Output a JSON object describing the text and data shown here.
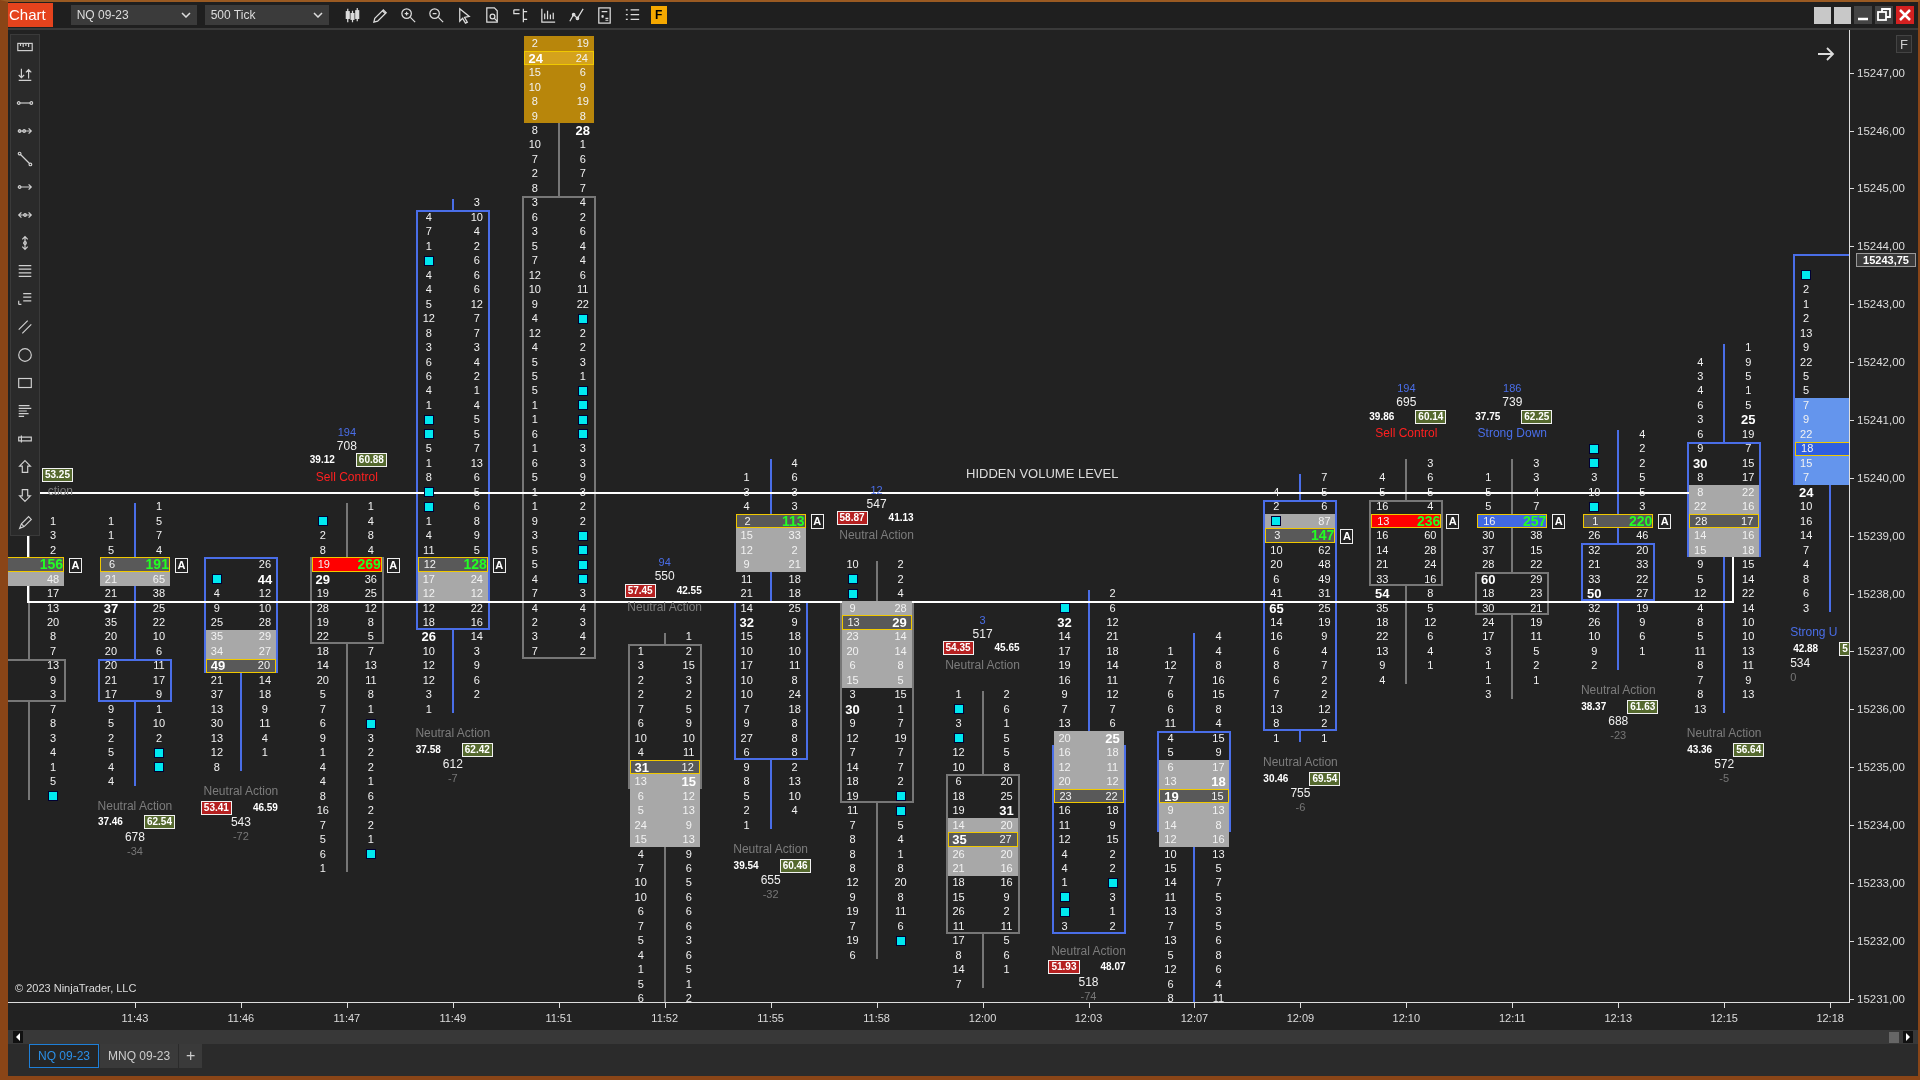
{
  "toolbar": {
    "app_label": "Chart",
    "instrument": "NQ 09-23",
    "interval": "500 Tick",
    "f_button": "F"
  },
  "chart": {
    "corner_button": "F",
    "hidden_volume_label": "HIDDEN VOLUME LEVEL",
    "copyright": "© 2023 NinjaTrader, LLC",
    "current_price": "15243,75",
    "price_labels": [
      "15247,00",
      "15246,00",
      "15245,00",
      "15244,00",
      "15243,00",
      "15242,00",
      "15241,00",
      "15240,00",
      "15239,00",
      "15238,00",
      "15237,00",
      "15236,00",
      "15235,00",
      "15234,00",
      "15233,00",
      "15232,00",
      "15231,00"
    ],
    "bars": [
      {
        "kind": "down",
        "poc": {
          "color": "#595959"
        },
        "value_area": {
          "color": "#a8a8a8"
        },
        "absorption": "A",
        "rows": [
          [
            "1"
          ],
          [
            "3"
          ],
          [
            "2"
          ],
          [
            "156"
          ],
          [
            "48"
          ],
          [
            "17"
          ],
          [
            "13"
          ],
          [
            "20"
          ],
          [
            "8"
          ],
          [
            "7"
          ],
          [
            "13"
          ],
          [
            "9"
          ],
          [
            "3"
          ],
          [
            "7"
          ],
          [
            "8"
          ],
          [
            "3"
          ],
          [
            "4"
          ],
          [
            "1"
          ],
          [
            "5"
          ],
          [
            {
              "marker": true
            }
          ]
        ],
        "summary": {
          "signal": {
            "text": "ction",
            "color": "#7c7c7c"
          },
          "ask_pct": {
            "text": "53.25",
            "boxed": true
          }
        }
      },
      {
        "time": "11:43",
        "kind": "up",
        "poc": {
          "color": "#595959"
        },
        "value_area": {
          "color": "#a8a8a8"
        },
        "absorption": "A",
        "rows": [
          [
            null,
            "1"
          ],
          [
            "1",
            "5"
          ],
          [
            "1",
            "7"
          ],
          [
            "5",
            "4"
          ],
          [
            "6",
            "191"
          ],
          [
            "21",
            "65"
          ],
          [
            "21",
            "38"
          ],
          [
            "37",
            "25"
          ],
          [
            "35",
            "22"
          ],
          [
            "20",
            "10"
          ],
          [
            "20",
            "6"
          ],
          [
            "20",
            "11"
          ],
          [
            "21",
            "17"
          ],
          [
            "17",
            "9"
          ],
          [
            "9",
            "1"
          ],
          [
            "5",
            "10"
          ],
          [
            "2",
            "2"
          ],
          [
            "5",
            {
              "marker": true
            }
          ],
          [
            "4",
            {
              "marker": true
            }
          ],
          [
            "4",
            null
          ]
        ],
        "summary": {
          "signal": {
            "text": "Neutral Action",
            "color": "#7c7c7c"
          },
          "bid_pct": {
            "text": "37.46",
            "boxed": false
          },
          "ask_pct": {
            "text": "62.54",
            "boxed": true
          },
          "volume": "678",
          "delta": "-34"
        }
      },
      {
        "time": "11:46",
        "kind": "up",
        "poc": {
          "color": "#595959"
        },
        "value_area": {
          "color": "#a8a8a8"
        },
        "rows": [
          [
            null,
            "26"
          ],
          [
            {
              "marker": true
            },
            "44"
          ],
          [
            "4",
            "12"
          ],
          [
            "9",
            "10"
          ],
          [
            "25",
            "28"
          ],
          [
            "35",
            "29"
          ],
          [
            "34",
            "27"
          ],
          [
            "49",
            "20"
          ],
          [
            "21",
            "14"
          ],
          [
            "37",
            "18"
          ],
          [
            "13",
            "9"
          ],
          [
            "30",
            "11"
          ],
          [
            "13",
            "4"
          ],
          [
            "12",
            "1"
          ],
          [
            "8",
            null
          ]
        ],
        "summary": {
          "signal": {
            "text": "Neutral Action",
            "color": "#7c7c7c"
          },
          "bid_pct": {
            "text": "53.41",
            "boxed": true
          },
          "ask_pct": {
            "text": "46.59",
            "boxed": false
          },
          "volume": "543",
          "delta": "-72"
        }
      },
      {
        "time": "11:47",
        "kind": "down",
        "poc": {
          "color": "#ff0000"
        },
        "absorption": "A",
        "rows": [
          [
            null,
            "1"
          ],
          [
            {
              "marker": true
            },
            "4"
          ],
          [
            "2",
            "8"
          ],
          [
            "8",
            "4"
          ],
          [
            "19",
            "269"
          ],
          [
            "29",
            "36"
          ],
          [
            "19",
            "25"
          ],
          [
            "28",
            "12"
          ],
          [
            "19",
            "8"
          ],
          [
            "22",
            "5"
          ],
          [
            "18",
            "7"
          ],
          [
            "14",
            "13"
          ],
          [
            "20",
            "11"
          ],
          [
            "5",
            "8"
          ],
          [
            "7",
            "1"
          ],
          [
            "6",
            {
              "marker": true
            }
          ],
          [
            "9",
            "3"
          ],
          [
            "1",
            "2"
          ],
          [
            "4",
            "2"
          ],
          [
            "4",
            "1"
          ],
          [
            "8",
            "6"
          ],
          [
            "16",
            "2"
          ],
          [
            "7",
            "2"
          ],
          [
            "5",
            "1"
          ],
          [
            "6",
            {
              "marker": true
            }
          ],
          [
            "1",
            null
          ]
        ],
        "summary": {
          "signal": {
            "text": "Sell Control",
            "color": "#ff2020"
          },
          "bid_pct": {
            "text": "39.12",
            "boxed": false
          },
          "ask_pct": {
            "text": "60.88",
            "boxed": true
          },
          "volume": "708",
          "delta": "194"
        }
      },
      {
        "time": "11:49",
        "kind": "up",
        "poc": {
          "color": "#595959"
        },
        "value_area": {
          "color": "#a8a8a8"
        },
        "absorption": "A",
        "rows": [
          [
            null,
            "3"
          ],
          [
            "4",
            "10"
          ],
          [
            "7",
            "4"
          ],
          [
            "1",
            "2"
          ],
          [
            {
              "marker": true
            },
            "6"
          ],
          [
            "4",
            "6"
          ],
          [
            "4",
            "6"
          ],
          [
            "5",
            "12"
          ],
          [
            "12",
            "7"
          ],
          [
            "8",
            "7"
          ],
          [
            "3",
            "3"
          ],
          [
            "6",
            "4"
          ],
          [
            "6",
            "2"
          ],
          [
            "4",
            "1"
          ],
          [
            "1",
            "4"
          ],
          [
            {
              "marker": true
            },
            "5"
          ],
          [
            {
              "marker": true
            },
            "5"
          ],
          [
            "5",
            "7"
          ],
          [
            "1",
            "13"
          ],
          [
            "8",
            "6"
          ],
          [
            {
              "marker": true
            },
            "5"
          ],
          [
            {
              "marker": true
            },
            "6"
          ],
          [
            "1",
            "8"
          ],
          [
            "4",
            "9"
          ],
          [
            "11",
            "5"
          ],
          [
            "12",
            "128"
          ],
          [
            "17",
            "24"
          ],
          [
            "12",
            "12"
          ],
          [
            "12",
            "22"
          ],
          [
            "18",
            "16"
          ],
          [
            "26",
            "14"
          ],
          [
            "10",
            "3"
          ],
          [
            "12",
            "9"
          ],
          [
            "12",
            "6"
          ],
          [
            "3",
            "2"
          ],
          [
            "1",
            null
          ]
        ],
        "summary": {
          "signal": {
            "text": "Neutral Action",
            "color": "#7c7c7c"
          },
          "bid_pct": {
            "text": "37.58",
            "boxed": false
          },
          "ask_pct": {
            "text": "62.42",
            "boxed": true
          },
          "volume": "612",
          "delta": "-7"
        }
      },
      {
        "time": "11:51",
        "kind": "down",
        "poc": {
          "color": "#d4a21c"
        },
        "value_area": {
          "color": "#b8860b"
        },
        "rows": [
          [
            "2",
            "19"
          ],
          [
            "24",
            "24"
          ],
          [
            "15",
            "6"
          ],
          [
            "10",
            "9"
          ],
          [
            "8",
            "19"
          ],
          [
            "9",
            "8"
          ],
          [
            "8",
            "28"
          ],
          [
            "10",
            "1"
          ],
          [
            "7",
            "6"
          ],
          [
            "2",
            "7"
          ],
          [
            "8",
            "7"
          ],
          [
            "3",
            "4"
          ],
          [
            "6",
            "2"
          ],
          [
            "3",
            "6"
          ],
          [
            "5",
            "4"
          ],
          [
            "7",
            "4"
          ],
          [
            "12",
            "6"
          ],
          [
            "10",
            "11"
          ],
          [
            "9",
            "22"
          ],
          [
            "4",
            {
              "marker": true
            }
          ],
          [
            "12",
            "2"
          ],
          [
            "4",
            "2"
          ],
          [
            "5",
            "3"
          ],
          [
            "5",
            "1"
          ],
          [
            "5",
            {
              "marker": true
            }
          ],
          [
            "1",
            {
              "marker": true
            }
          ],
          [
            "1",
            {
              "marker": true
            }
          ],
          [
            "6",
            {
              "marker": true
            }
          ],
          [
            "1",
            "3"
          ],
          [
            "6",
            "3"
          ],
          [
            "5",
            "9"
          ],
          [
            "1",
            "3"
          ],
          [
            "1",
            "2"
          ],
          [
            "9",
            "2"
          ],
          [
            "3",
            {
              "marker": true
            }
          ],
          [
            "5",
            {
              "marker": true
            }
          ],
          [
            "5",
            {
              "marker": true
            }
          ],
          [
            "4",
            {
              "marker": true
            }
          ],
          [
            "7",
            "3"
          ],
          [
            "4",
            "4"
          ],
          [
            "2",
            "3"
          ],
          [
            "3",
            "4"
          ],
          [
            "7",
            "2"
          ]
        ]
      },
      {
        "time": "11:52",
        "kind": "down",
        "poc": {
          "color": "#595959"
        },
        "value_area": {
          "color": "#a8a8a8"
        },
        "rows": [
          [
            null,
            "1"
          ],
          [
            "1",
            "2"
          ],
          [
            "3",
            "15"
          ],
          [
            "2",
            "3"
          ],
          [
            "2",
            "2"
          ],
          [
            "7",
            "5"
          ],
          [
            "6",
            "9"
          ],
          [
            "10",
            "10"
          ],
          [
            "4",
            "11"
          ],
          [
            "31",
            "12"
          ],
          [
            "13",
            "15"
          ],
          [
            "6",
            "12"
          ],
          [
            "5",
            "13"
          ],
          [
            "24",
            "9"
          ],
          [
            "15",
            "13"
          ],
          [
            "4",
            "9"
          ],
          [
            "7",
            "6"
          ],
          [
            "10",
            "5"
          ],
          [
            "10",
            "6"
          ],
          [
            "6",
            "6"
          ],
          [
            "7",
            "6"
          ],
          [
            "5",
            "3"
          ],
          [
            "4",
            "6"
          ],
          [
            "1",
            "5"
          ],
          [
            "5",
            "1"
          ],
          [
            "6",
            "2"
          ]
        ],
        "summary": {
          "signal": {
            "text": "Neutral Action",
            "color": "#7c7c7c"
          },
          "bid_pct": {
            "text": "57.45",
            "boxed": true
          },
          "ask_pct": {
            "text": "42.55",
            "boxed": false
          },
          "volume": "550",
          "delta": "94"
        }
      },
      {
        "time": "11:55",
        "kind": "up",
        "poc": {
          "color": "#595959"
        },
        "value_area": {
          "color": "#a8a8a8"
        },
        "absorption": "A",
        "rows": [
          [
            null,
            "4"
          ],
          [
            "1",
            "6"
          ],
          [
            "3",
            "3"
          ],
          [
            "4",
            "3"
          ],
          [
            "2",
            "113"
          ],
          [
            "15",
            "33"
          ],
          [
            "12",
            "2"
          ],
          [
            "9",
            "21"
          ],
          [
            "11",
            "18"
          ],
          [
            "21",
            "18"
          ],
          [
            "14",
            "25"
          ],
          [
            "32",
            "9"
          ],
          [
            "15",
            "18"
          ],
          [
            "10",
            "10"
          ],
          [
            "17",
            "11"
          ],
          [
            "10",
            "8"
          ],
          [
            "10",
            "24"
          ],
          [
            "7",
            "18"
          ],
          [
            "9",
            "8"
          ],
          [
            "27",
            "8"
          ],
          [
            "6",
            "8"
          ],
          [
            "9",
            "2"
          ],
          [
            "8",
            "13"
          ],
          [
            "5",
            "10"
          ],
          [
            "2",
            "4"
          ],
          [
            "1",
            null
          ]
        ],
        "summary": {
          "signal": {
            "text": "Neutral Action",
            "color": "#7c7c7c"
          },
          "bid_pct": {
            "text": "39.54",
            "boxed": false
          },
          "ask_pct": {
            "text": "60.46",
            "boxed": true
          },
          "volume": "655",
          "delta": "-32"
        }
      },
      {
        "time": "11:58",
        "kind": "down",
        "poc": {
          "color": "#595959"
        },
        "value_area": {
          "color": "#a8a8a8"
        },
        "rows": [
          [
            "10",
            "2"
          ],
          [
            {
              "marker": true
            },
            "2"
          ],
          [
            {
              "marker": true
            },
            "4"
          ],
          [
            "9",
            "28"
          ],
          [
            "13",
            "29"
          ],
          [
            "23",
            "14"
          ],
          [
            "20",
            "14"
          ],
          [
            "6",
            "8"
          ],
          [
            "15",
            "5"
          ],
          [
            "3",
            "15"
          ],
          [
            "30",
            "1"
          ],
          [
            "9",
            "7"
          ],
          [
            "12",
            "19"
          ],
          [
            "7",
            "7"
          ],
          [
            "14",
            "7"
          ],
          [
            "18",
            "2"
          ],
          [
            "19",
            {
              "marker": true
            }
          ],
          [
            "11",
            {
              "marker": true
            }
          ],
          [
            "7",
            "5"
          ],
          [
            "8",
            "4"
          ],
          [
            "8",
            "1"
          ],
          [
            "8",
            "8"
          ],
          [
            "12",
            "20"
          ],
          [
            "9",
            "8"
          ],
          [
            "19",
            "11"
          ],
          [
            "7",
            "6"
          ],
          [
            "19",
            {
              "marker": true
            }
          ],
          [
            "6",
            null
          ]
        ],
        "summary": {
          "signal": {
            "text": "Neutral Action",
            "color": "#7c7c7c"
          },
          "bid_pct": {
            "text": "58.87",
            "boxed": true
          },
          "ask_pct": {
            "text": "41.13",
            "boxed": false
          },
          "volume": "547",
          "delta": "12"
        }
      },
      {
        "time": "12:00",
        "kind": "down",
        "poc": {
          "color": "#595959"
        },
        "value_area": {
          "color": "#a8a8a8"
        },
        "rows": [
          [
            "1",
            "2"
          ],
          [
            {
              "marker": true
            },
            "6"
          ],
          [
            "3",
            "1"
          ],
          [
            {
              "marker": true
            },
            "5"
          ],
          [
            "12",
            "5"
          ],
          [
            "10",
            "8"
          ],
          [
            "6",
            "20"
          ],
          [
            "18",
            "25"
          ],
          [
            "19",
            "31"
          ],
          [
            "14",
            "20"
          ],
          [
            "35",
            "27"
          ],
          [
            "26",
            "20"
          ],
          [
            "21",
            "16"
          ],
          [
            "18",
            "16"
          ],
          [
            "15",
            "9"
          ],
          [
            "26",
            "2"
          ],
          [
            "11",
            "11"
          ],
          [
            "17",
            "5"
          ],
          [
            "8",
            "6"
          ],
          [
            "14",
            "1"
          ],
          [
            "7",
            null
          ]
        ],
        "summary": {
          "signal": {
            "text": "Neutral Action",
            "color": "#7c7c7c"
          },
          "bid_pct": {
            "text": "54.35",
            "boxed": true
          },
          "ask_pct": {
            "text": "45.65",
            "boxed": false
          },
          "volume": "517",
          "delta": "3"
        }
      },
      {
        "time": "12:03",
        "kind": "up",
        "poc": {
          "color": "#595959"
        },
        "value_area": {
          "color": "#a8a8a8"
        },
        "rows": [
          [
            null,
            "2"
          ],
          [
            {
              "marker": true
            },
            "6"
          ],
          [
            "32",
            "12"
          ],
          [
            "14",
            "21"
          ],
          [
            "17",
            "18"
          ],
          [
            "19",
            "14"
          ],
          [
            "16",
            "11"
          ],
          [
            "9",
            "12"
          ],
          [
            "7",
            "7"
          ],
          [
            "13",
            "6"
          ],
          [
            "20",
            "25"
          ],
          [
            "16",
            "18"
          ],
          [
            "12",
            "11"
          ],
          [
            "20",
            "12"
          ],
          [
            "23",
            "22"
          ],
          [
            "16",
            "18"
          ],
          [
            "11",
            "9"
          ],
          [
            "12",
            "15"
          ],
          [
            "4",
            "2"
          ],
          [
            "4",
            "2"
          ],
          [
            "1",
            {
              "marker": true
            }
          ],
          [
            {
              "marker": true
            },
            "3"
          ],
          [
            {
              "marker": true
            },
            "1"
          ],
          [
            "3",
            "2"
          ]
        ],
        "summary": {
          "signal": {
            "text": "Neutral Action",
            "color": "#7c7c7c"
          },
          "bid_pct": {
            "text": "51.93",
            "boxed": true
          },
          "ask_pct": {
            "text": "48.07",
            "boxed": false
          },
          "volume": "518",
          "delta": "-74"
        }
      },
      {
        "time": "12:07",
        "kind": "up",
        "poc": {
          "color": "#595959"
        },
        "value_area": {
          "color": "#a8a8a8"
        },
        "rows": [
          [
            null,
            "4"
          ],
          [
            "1",
            "4"
          ],
          [
            "12",
            "8"
          ],
          [
            "7",
            "16"
          ],
          [
            "6",
            "15"
          ],
          [
            "6",
            "8"
          ],
          [
            "11",
            "4"
          ],
          [
            "4",
            "15"
          ],
          [
            "5",
            "9"
          ],
          [
            "6",
            "17"
          ],
          [
            "13",
            "18"
          ],
          [
            "19",
            "15"
          ],
          [
            "9",
            "13"
          ],
          [
            "14",
            "8"
          ],
          [
            "12",
            "16"
          ],
          [
            "10",
            "13"
          ],
          [
            "15",
            "5"
          ],
          [
            "14",
            "7"
          ],
          [
            "11",
            "5"
          ],
          [
            "13",
            "3"
          ],
          [
            "7",
            "5"
          ],
          [
            "13",
            "6"
          ],
          [
            "5",
            "8"
          ],
          [
            "12",
            "6"
          ],
          [
            "6",
            "4"
          ],
          [
            "8",
            "11"
          ]
        ]
      },
      {
        "time": "12:09",
        "kind": "up",
        "poc": {
          "color": "#595959"
        },
        "value_area": {
          "color": "#a8a8a8"
        },
        "absorption": "A",
        "rows": [
          [
            null,
            "7"
          ],
          [
            "4",
            "5"
          ],
          [
            "2",
            "6"
          ],
          [
            {
              "marker": true
            },
            "87"
          ],
          [
            "3",
            "147"
          ],
          [
            "10",
            "62"
          ],
          [
            "20",
            "48"
          ],
          [
            "6",
            "49"
          ],
          [
            "41",
            "31"
          ],
          [
            "65",
            "25"
          ],
          [
            "14",
            "19"
          ],
          [
            "16",
            "9"
          ],
          [
            "6",
            "4"
          ],
          [
            "8",
            "7"
          ],
          [
            "6",
            "2"
          ],
          [
            "7",
            "2"
          ],
          [
            "13",
            "12"
          ],
          [
            "8",
            "2"
          ],
          [
            "1",
            "1"
          ]
        ],
        "summary": {
          "signal": {
            "text": "Neutral Action",
            "color": "#7c7c7c"
          },
          "bid_pct": {
            "text": "30.46",
            "boxed": false
          },
          "ask_pct": {
            "text": "69.54",
            "boxed": true
          },
          "volume": "755",
          "delta": "-6"
        }
      },
      {
        "time": "12:10",
        "kind": "down",
        "poc": {
          "color": "#ff0000"
        },
        "absorption": "A",
        "rows": [
          [
            null,
            "3"
          ],
          [
            "4",
            "6"
          ],
          [
            "5",
            "5"
          ],
          [
            "16",
            "4"
          ],
          [
            "13",
            "236"
          ],
          [
            "16",
            "60"
          ],
          [
            "14",
            "28"
          ],
          [
            "21",
            "24"
          ],
          [
            "33",
            "16"
          ],
          [
            "54",
            "8"
          ],
          [
            "35",
            "5"
          ],
          [
            "18",
            "12"
          ],
          [
            "22",
            "6"
          ],
          [
            "13",
            "4"
          ],
          [
            "9",
            "1"
          ],
          [
            "4",
            null
          ]
        ],
        "summary": {
          "signal": {
            "text": "Sell Control",
            "color": "#ff2020"
          },
          "bid_pct": {
            "text": "39.86",
            "boxed": false
          },
          "ask_pct": {
            "text": "60.14",
            "boxed": true
          },
          "volume": "695",
          "delta": "194"
        }
      },
      {
        "time": "12:11",
        "kind": "down",
        "poc": {
          "color": "#4169e1"
        },
        "absorption": "A",
        "rows": [
          [
            null,
            "3"
          ],
          [
            "1",
            "3"
          ],
          [
            "5",
            "4"
          ],
          [
            "5",
            "7"
          ],
          [
            "16",
            "257"
          ],
          [
            "30",
            "38"
          ],
          [
            "37",
            "15"
          ],
          [
            "28",
            "22"
          ],
          [
            "60",
            "29"
          ],
          [
            "18",
            "23"
          ],
          [
            "30",
            "21"
          ],
          [
            "24",
            "19"
          ],
          [
            "17",
            "11"
          ],
          [
            "3",
            "5"
          ],
          [
            "1",
            "2"
          ],
          [
            "1",
            "1"
          ],
          [
            "3",
            null
          ]
        ],
        "summary": {
          "signal": {
            "text": "Strong Down",
            "color": "#4a6ee8"
          },
          "bid_pct": {
            "text": "37.75",
            "boxed": false
          },
          "ask_pct": {
            "text": "62.25",
            "boxed": true
          },
          "volume": "739",
          "delta": "186"
        }
      },
      {
        "time": "12:13",
        "kind": "up",
        "poc": {
          "color": "#595959"
        },
        "absorption": "A",
        "rows": [
          [
            null,
            "4"
          ],
          [
            {
              "marker": true
            },
            "2"
          ],
          [
            {
              "marker": true
            },
            "2"
          ],
          [
            "3",
            "5"
          ],
          [
            "10",
            "5"
          ],
          [
            {
              "marker": true
            },
            "3"
          ],
          [
            "1",
            "220"
          ],
          [
            "26",
            "46"
          ],
          [
            "32",
            "20"
          ],
          [
            "21",
            "33"
          ],
          [
            "33",
            "22"
          ],
          [
            "50",
            "27"
          ],
          [
            "32",
            "19"
          ],
          [
            "26",
            "9"
          ],
          [
            "10",
            "6"
          ],
          [
            "9",
            "1"
          ],
          [
            "2",
            null
          ]
        ],
        "summary": {
          "signal": {
            "text": "Neutral Action",
            "color": "#7c7c7c"
          },
          "bid_pct": {
            "text": "38.37",
            "boxed": false
          },
          "ask_pct": {
            "text": "61.63",
            "boxed": true
          },
          "volume": "688",
          "delta": "-23"
        }
      },
      {
        "time": "12:15",
        "kind": "up",
        "poc": {
          "color": "#595959"
        },
        "value_area": {
          "color": "#a8a8a8"
        },
        "rows": [
          [
            null,
            "1"
          ],
          [
            "4",
            "9"
          ],
          [
            "3",
            "5"
          ],
          [
            "4",
            "1"
          ],
          [
            "6",
            "5"
          ],
          [
            "3",
            "25"
          ],
          [
            "6",
            "19"
          ],
          [
            "9",
            "7"
          ],
          [
            "30",
            "15"
          ],
          [
            "8",
            "17"
          ],
          [
            "8",
            "22"
          ],
          [
            "22",
            "16"
          ],
          [
            "28",
            "17"
          ],
          [
            "14",
            "16"
          ],
          [
            "15",
            "18"
          ],
          [
            "9",
            "15"
          ],
          [
            "5",
            "14"
          ],
          [
            "12",
            "22"
          ],
          [
            "4",
            "14"
          ],
          [
            "8",
            "10"
          ],
          [
            "5",
            "10"
          ],
          [
            "11",
            "13"
          ],
          [
            "8",
            "11"
          ],
          [
            "7",
            "9"
          ],
          [
            "8",
            "13"
          ],
          [
            "13",
            null
          ]
        ],
        "summary": {
          "signal": {
            "text": "Neutral Action",
            "color": "#7c7c7c"
          },
          "bid_pct": {
            "text": "43.36",
            "boxed": false
          },
          "ask_pct": {
            "text": "56.64",
            "boxed": true
          },
          "volume": "572",
          "delta": "-5"
        }
      },
      {
        "time": "12:18",
        "kind": "up",
        "poc": {
          "color": "#2f5fe0"
        },
        "value_area": {
          "color": "#6495ed"
        },
        "rows": [
          [
            {
              "marker": true
            }
          ],
          [
            "2"
          ],
          [
            "1"
          ],
          [
            "2"
          ],
          [
            "13"
          ],
          [
            "9"
          ],
          [
            "22"
          ],
          [
            "5"
          ],
          [
            "5"
          ],
          [
            "7"
          ],
          [
            "9"
          ],
          [
            "22"
          ],
          [
            "18"
          ],
          [
            "15"
          ],
          [
            "7"
          ],
          [
            "24"
          ],
          [
            "10"
          ],
          [
            "16"
          ],
          [
            "14"
          ],
          [
            "7"
          ],
          [
            "4"
          ],
          [
            "8"
          ],
          [
            "6"
          ],
          [
            "3"
          ]
        ],
        "summary": {
          "signal": {
            "text": "Strong U",
            "color": "#4a6ee8"
          },
          "bid_pct": {
            "text": "42.88",
            "boxed": false
          },
          "ask_pct": {
            "text": "5",
            "boxed": true
          },
          "volume": "534",
          "delta": "0"
        }
      }
    ]
  },
  "tabs": [
    {
      "label": "NQ 09-23",
      "selected": true
    },
    {
      "label": "MNQ 09-23",
      "selected": false
    }
  ],
  "add_tab": "+"
}
